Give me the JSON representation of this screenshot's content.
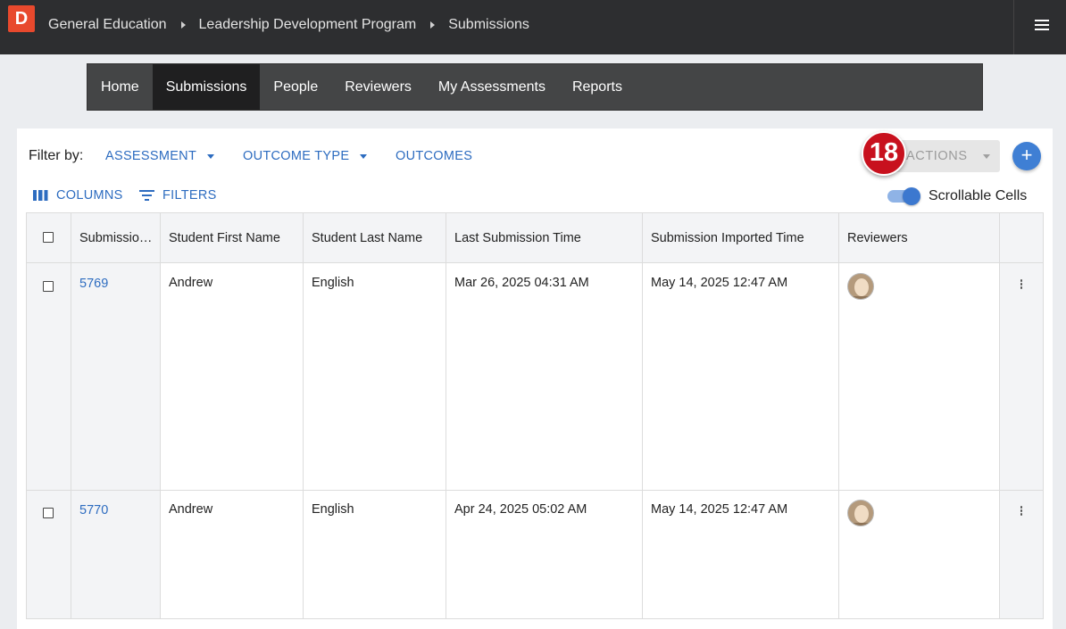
{
  "app": {
    "logo_letter": "D",
    "breadcrumbs": [
      "General Education",
      "Leadership Development Program",
      "Submissions"
    ],
    "menu_icon": "hamburger-menu-icon"
  },
  "nav": {
    "items": [
      {
        "label": "Home",
        "active": false
      },
      {
        "label": "Submissions",
        "active": true
      },
      {
        "label": "People",
        "active": false
      },
      {
        "label": "Reviewers",
        "active": false
      },
      {
        "label": "My Assessments",
        "active": false
      },
      {
        "label": "Reports",
        "active": false
      }
    ]
  },
  "toolbar": {
    "filter_label": "Filter by:",
    "assessment": "ASSESSMENT",
    "outcome_type": "OUTCOME TYPE",
    "outcomes": "OUTCOMES",
    "actions": "ACTIONS",
    "add_icon": "plus-icon",
    "columns": "COLUMNS",
    "filters": "FILTERS",
    "scrollable_cells": "Scrollable Cells",
    "scrollable_cells_on": true
  },
  "table": {
    "headers": {
      "submission": "Submissio…",
      "first_name": "Student First Name",
      "last_name": "Student Last Name",
      "last_submission": "Last Submission Time",
      "imported": "Submission Imported Time",
      "reviewers": "Reviewers"
    },
    "rows": [
      {
        "id": "5769",
        "first": "Andrew",
        "last": "English",
        "submitted": "Mar 26, 2025 04:31 AM",
        "imported": "May 14, 2025 12:47 AM"
      },
      {
        "id": "5770",
        "first": "Andrew",
        "last": "English",
        "submitted": "Apr 24, 2025 05:02 AM",
        "imported": "May 14, 2025 12:47 AM"
      }
    ]
  },
  "annotation": {
    "badge": "18",
    "color": "#c8111e"
  },
  "colors": {
    "accent": "#2d6cc0",
    "topbar": "#2d2e30",
    "logo": "#e8492d"
  }
}
